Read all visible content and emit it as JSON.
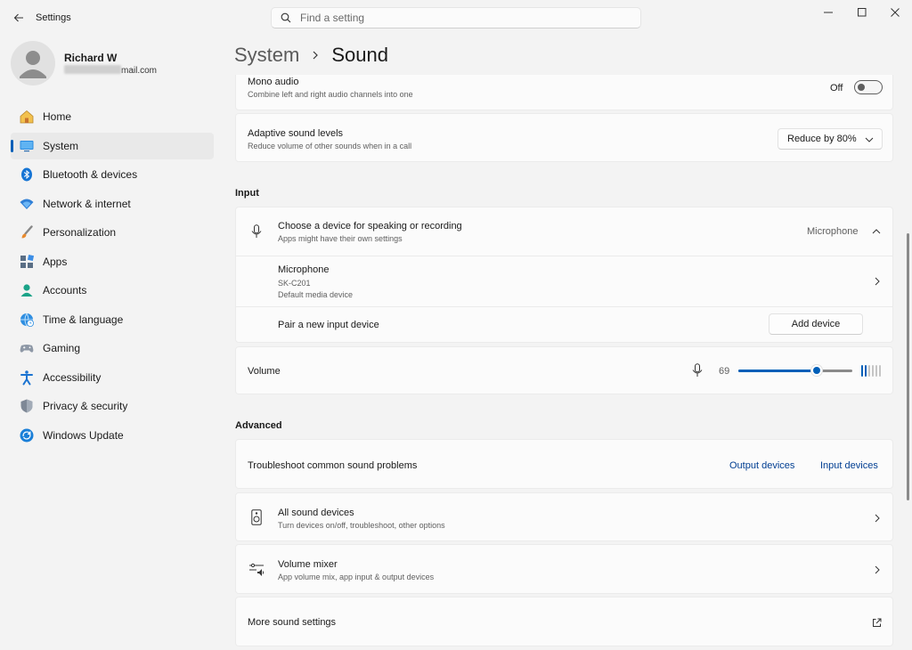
{
  "window": {
    "app_title": "Settings",
    "search_placeholder": "Find a setting"
  },
  "profile": {
    "name": "Richard W",
    "email_suffix": "mail.com"
  },
  "nav": {
    "items": [
      {
        "label": "Home",
        "icon": "home-icon",
        "active": false
      },
      {
        "label": "System",
        "icon": "system-icon",
        "active": true
      },
      {
        "label": "Bluetooth & devices",
        "icon": "bluetooth-icon",
        "active": false
      },
      {
        "label": "Network & internet",
        "icon": "network-icon",
        "active": false
      },
      {
        "label": "Personalization",
        "icon": "brush-icon",
        "active": false
      },
      {
        "label": "Apps",
        "icon": "apps-icon",
        "active": false
      },
      {
        "label": "Accounts",
        "icon": "accounts-icon",
        "active": false
      },
      {
        "label": "Time & language",
        "icon": "globe-icon",
        "active": false
      },
      {
        "label": "Gaming",
        "icon": "gamepad-icon",
        "active": false
      },
      {
        "label": "Accessibility",
        "icon": "accessibility-icon",
        "active": false
      },
      {
        "label": "Privacy & security",
        "icon": "shield-icon",
        "active": false
      },
      {
        "label": "Windows Update",
        "icon": "update-icon",
        "active": false
      }
    ]
  },
  "breadcrumb": {
    "parent": "System",
    "current": "Sound"
  },
  "mono_audio": {
    "title": "Mono audio",
    "subtitle": "Combine left and right audio channels into one",
    "state_label": "Off"
  },
  "adaptive": {
    "title": "Adaptive sound levels",
    "subtitle": "Reduce volume of other sounds when in a call",
    "selected": "Reduce by 80%"
  },
  "input_section": {
    "title": "Input",
    "choose_title": "Choose a device for speaking or recording",
    "choose_subtitle": "Apps might have their own settings",
    "choose_value": "Microphone",
    "device_title": "Microphone",
    "device_model": "SK-C201",
    "device_status": "Default media device",
    "pair_title": "Pair a new input device",
    "add_button": "Add device",
    "volume_label": "Volume",
    "volume_value": "69",
    "volume_fraction": 0.69,
    "meter_level": 2,
    "meter_total": 6
  },
  "advanced": {
    "title": "Advanced",
    "troubleshoot_title": "Troubleshoot common sound problems",
    "output_link": "Output devices",
    "input_link": "Input devices",
    "all_devices_title": "All sound devices",
    "all_devices_subtitle": "Turn devices on/off, troubleshoot, other options",
    "mixer_title": "Volume mixer",
    "mixer_subtitle": "App volume mix, app input & output devices",
    "more_title": "More sound settings"
  },
  "colors": {
    "accent": "#005fb8",
    "link": "#003e92"
  }
}
